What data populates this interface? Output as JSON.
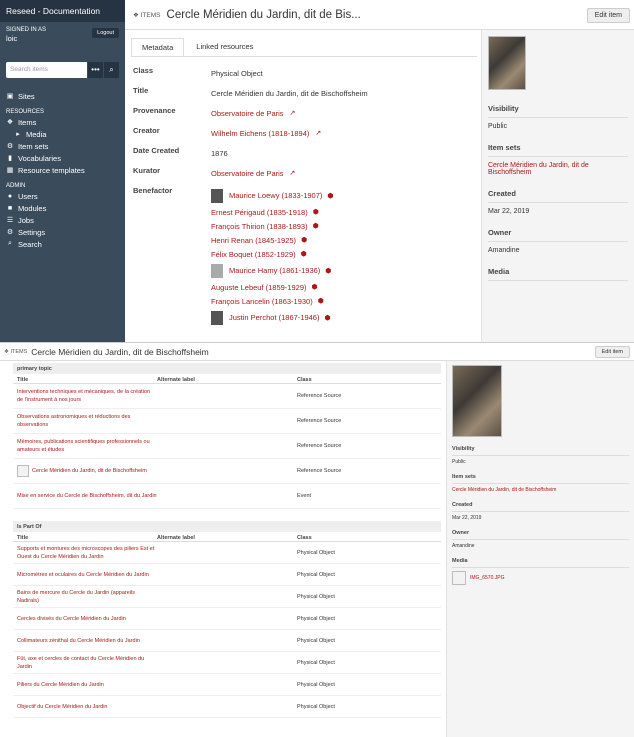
{
  "top": {
    "sidebar": {
      "brand": "Reseed - Documentation",
      "signed_label": "SIGNED IN AS",
      "user": "loic",
      "logout": "Logout",
      "search_placeholder": "Search items",
      "search_more": "•••",
      "search_icon": "magnifier-icon",
      "sites": "Sites",
      "resources_head": "RESOURCES",
      "items": "Items",
      "media": "Media",
      "item_sets": "Item sets",
      "vocabularies": "Vocabularies",
      "resource_templates": "Resource templates",
      "admin_head": "ADMIN",
      "users": "Users",
      "modules": "Modules",
      "jobs": "Jobs",
      "settings": "Settings",
      "search": "Search"
    },
    "header": {
      "section": "ITEMS",
      "title": "Cercle Méridien du Jardin, dit de Bis...",
      "edit": "Edit item"
    },
    "tabs": [
      "Metadata",
      "Linked resources"
    ],
    "properties": [
      {
        "label": "Class",
        "values": [
          {
            "text": "Physical Object",
            "link": false
          }
        ]
      },
      {
        "label": "Title",
        "values": [
          {
            "text": "Cercle Méridien du Jardin, dit de Bischoffsheim",
            "link": false
          }
        ]
      },
      {
        "label": "Provenance",
        "values": [
          {
            "text": "Observatoire de Paris",
            "link": true,
            "ext": true
          }
        ]
      },
      {
        "label": "Creator",
        "values": [
          {
            "text": "Wilhelm Eichens (1818-1894)",
            "link": true,
            "ext": true
          }
        ]
      },
      {
        "label": "Date Created",
        "values": [
          {
            "text": "1876",
            "link": false
          }
        ]
      },
      {
        "label": "Kurator",
        "values": [
          {
            "text": "Observatoire de Paris",
            "link": true,
            "ext": true
          }
        ]
      },
      {
        "label": "Benefactor",
        "values": [
          {
            "text": "Maurice Loewy (1833-1907)",
            "link": true,
            "gem": true,
            "thumb": "dark"
          },
          {
            "text": "Ernest Périgaud (1835-1918)",
            "link": true,
            "gem": true
          },
          {
            "text": "François Thirion (1838-1893)",
            "link": true,
            "gem": true
          },
          {
            "text": "Henri Renan (1845-1925)",
            "link": true,
            "gem": true
          },
          {
            "text": "Félix Boquet (1852-1929)",
            "link": true,
            "gem": true
          },
          {
            "text": "Maurice Hamy (1861-1936)",
            "link": true,
            "gem": true,
            "thumb": "light"
          },
          {
            "text": "Auguste Lebeuf (1859-1929)",
            "link": true,
            "gem": true
          },
          {
            "text": "François Lancelin (1863-1930)",
            "link": true,
            "gem": true
          },
          {
            "text": "Justin Perchot (1867-1946)",
            "link": true,
            "gem": true,
            "thumb": "dark"
          }
        ]
      }
    ],
    "rail": {
      "visibility_h": "Visibility",
      "visibility_v": "Public",
      "itemsets_h": "Item sets",
      "itemsets_v": "Cercle Méridien du Jardin, dit de Bischoffsheim",
      "created_h": "Created",
      "created_v": "Mar 22, 2019",
      "owner_h": "Owner",
      "owner_v": "Amandine",
      "media_h": "Media"
    }
  },
  "bottom": {
    "header": {
      "section": "ITEMS",
      "title": "Cercle Méridien du Jardin, dit de Bischoffsheim",
      "edit": "Edit item"
    },
    "sections": [
      {
        "heading": "primary topic",
        "columns": [
          "Title",
          "Alternate label",
          "Class"
        ],
        "rows": [
          {
            "title": "Interventions techniques et mécaniques, de la création de l'instrument à nos jours",
            "alt": "",
            "cls": "Reference Source"
          },
          {
            "title": "Observations astronomiques et réductions des observations",
            "alt": "",
            "cls": "Reference Source"
          },
          {
            "title": "Mémoires, publications scientifiques professionnels ou amateurs et études",
            "alt": "",
            "cls": "Reference Source"
          },
          {
            "title": "Cercle Méridien du Jardin, dit de Bischoffsheim",
            "alt": "",
            "cls": "Reference Source",
            "icon": true
          },
          {
            "title": "Mise en service du Cercle de Bischoffsheim, dit du Jardin",
            "alt": "",
            "cls": "Event"
          }
        ]
      },
      {
        "heading": "Is Part Of",
        "columns": [
          "Title",
          "Alternate label",
          "Class"
        ],
        "rows": [
          {
            "title": "Supports et montures des microscopes des piliers Est et Ouest du Cercle Méridien du Jardin",
            "alt": "",
            "cls": "Physical Object"
          },
          {
            "title": "Micromètres et oculaires du Cercle Méridien du Jardin",
            "alt": "",
            "cls": "Physical Object"
          },
          {
            "title": "Bains de mercure du Cercle du Jardin (appareils Nadirals)",
            "alt": "",
            "cls": "Physical Object"
          },
          {
            "title": "Cercles divisés du Cercle Méridien du Jardin",
            "alt": "",
            "cls": "Physical Object"
          },
          {
            "title": "Collimateurs zénithal du Cercle Méridien du Jardin",
            "alt": "",
            "cls": "Physical Object"
          },
          {
            "title": "Fût, axe et cercles de contact du Cercle Méridien du Jardin",
            "alt": "",
            "cls": "Physical Object"
          },
          {
            "title": "Piliers du Cercle Méridien du Jardin",
            "alt": "",
            "cls": "Physical Object"
          },
          {
            "title": "Objectif du Cercle Méridien du Jardin",
            "alt": "",
            "cls": "Physical Object"
          }
        ]
      }
    ],
    "rail": {
      "visibility_h": "Visibility",
      "visibility_v": "Public",
      "itemsets_h": "Item sets",
      "itemsets_v": "Cercle Méridien du Jardin, dit de Bischoffsheim",
      "created_h": "Created",
      "created_v": "Mar 22, 2019",
      "owner_h": "Owner",
      "owner_v": "Amandine",
      "media_h": "Media",
      "media_file": "IMG_6570.JPG"
    }
  }
}
